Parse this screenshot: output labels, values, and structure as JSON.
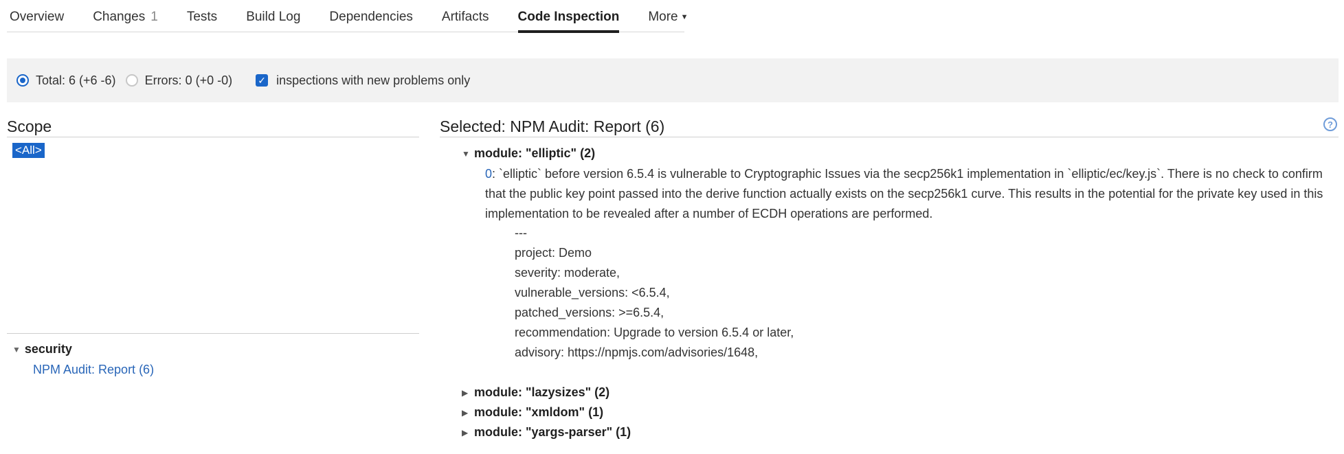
{
  "tabs": [
    {
      "label": "Overview"
    },
    {
      "label": "Changes",
      "count": "1"
    },
    {
      "label": "Tests"
    },
    {
      "label": "Build Log"
    },
    {
      "label": "Dependencies"
    },
    {
      "label": "Artifacts"
    },
    {
      "label": "Code Inspection",
      "active": true
    },
    {
      "label": "More"
    }
  ],
  "filter": {
    "total_label": "Total: 6 (+6 -6)",
    "errors_label": "Errors: 0 (+0 -0)",
    "new_only_label": "inspections with new problems only"
  },
  "scope": {
    "title": "Scope",
    "all_label": "<All>",
    "group_label": "security",
    "leaf_label": "NPM Audit: Report (6)"
  },
  "selected": {
    "title": "Selected: NPM Audit: Report (6)",
    "help": "?",
    "modules": [
      "module: \"elliptic\" (2)",
      "module: \"lazysizes\" (2)",
      "module: \"xmldom\" (1)",
      "module: \"yargs-parser\" (1)"
    ],
    "problem": {
      "index": "0",
      "text": ":  `elliptic` before version 6.5.4 is vulnerable to Cryptographic Issues via the secp256k1 implementation in `elliptic/ec/key.js`. There is no check to confirm that the public key point passed into the derive function actually exists on the secp256k1 curve. This results in the potential for the private key used in this implementation to be revealed after a number of ECDH operations are performed.",
      "details": [
        "---",
        "project: Demo",
        "severity: moderate,",
        "vulnerable_versions: <6.5.4,",
        "patched_versions: >=6.5.4,",
        "recommendation: Upgrade to version 6.5.4 or later,",
        "advisory: https://npmjs.com/advisories/1648,"
      ]
    }
  },
  "colors": {
    "accent": "#1a66c9",
    "link": "#2966b8",
    "filter_bg": "#f2f2f2"
  }
}
